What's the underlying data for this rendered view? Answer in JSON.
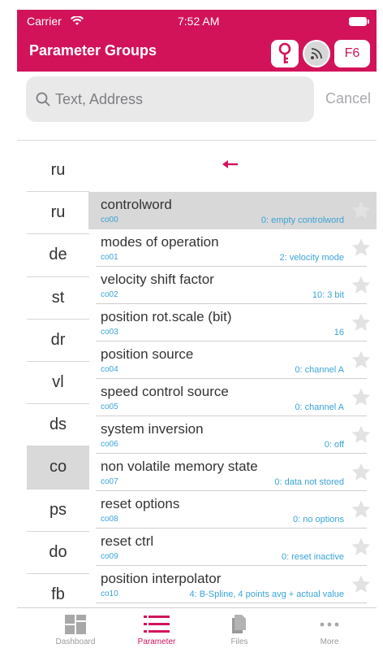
{
  "status_bar": {
    "carrier": "Carrier",
    "time": "7:52 AM"
  },
  "nav": {
    "title": "Parameter Groups",
    "f6_label": "F6"
  },
  "search": {
    "placeholder": "Text, Address",
    "cancel_label": "Cancel"
  },
  "groups": [
    {
      "label": "ru",
      "selected": false
    },
    {
      "label": "ru",
      "selected": false
    },
    {
      "label": "de",
      "selected": false
    },
    {
      "label": "st",
      "selected": false
    },
    {
      "label": "dr",
      "selected": false
    },
    {
      "label": "vl",
      "selected": false
    },
    {
      "label": "ds",
      "selected": false
    },
    {
      "label": "co",
      "selected": true
    },
    {
      "label": "ps",
      "selected": false
    },
    {
      "label": "do",
      "selected": false
    },
    {
      "label": "fb",
      "selected": false
    }
  ],
  "parameters": [
    {
      "name": "controlword",
      "address": "co00",
      "value": "0: empty controlword",
      "selected": true
    },
    {
      "name": "modes of operation",
      "address": "co01",
      "value": "2: velocity mode",
      "selected": false
    },
    {
      "name": "velocity shift factor",
      "address": "co02",
      "value": "10: 3 bit",
      "selected": false
    },
    {
      "name": "position rot.scale (bit)",
      "address": "co03",
      "value": "16",
      "selected": false
    },
    {
      "name": "position source",
      "address": "co04",
      "value": "0: channel A",
      "selected": false
    },
    {
      "name": "speed control source",
      "address": "co05",
      "value": "0: channel A",
      "selected": false
    },
    {
      "name": "system inversion",
      "address": "co06",
      "value": "0: off",
      "selected": false
    },
    {
      "name": "non volatile memory state",
      "address": "co07",
      "value": "0: data not stored",
      "selected": false
    },
    {
      "name": "reset options",
      "address": "co08",
      "value": "0: no options",
      "selected": false
    },
    {
      "name": "reset ctrl",
      "address": "co09",
      "value": "0: reset inactive",
      "selected": false
    },
    {
      "name": "position interpolator",
      "address": "co10",
      "value": "4: B-Spline, 4 points avg + actual value",
      "selected": false
    }
  ],
  "tabs": [
    {
      "label": "Dashboard",
      "icon": "dashboard-icon",
      "active": false
    },
    {
      "label": "Parameter",
      "icon": "list-icon",
      "active": true
    },
    {
      "label": "Files",
      "icon": "files-icon",
      "active": false
    },
    {
      "label": "More",
      "icon": "more-icon",
      "active": false
    }
  ],
  "colors": {
    "brand": "#d2135a",
    "value_text": "#3aa3d6",
    "selected_row": "#d8d8d8"
  }
}
